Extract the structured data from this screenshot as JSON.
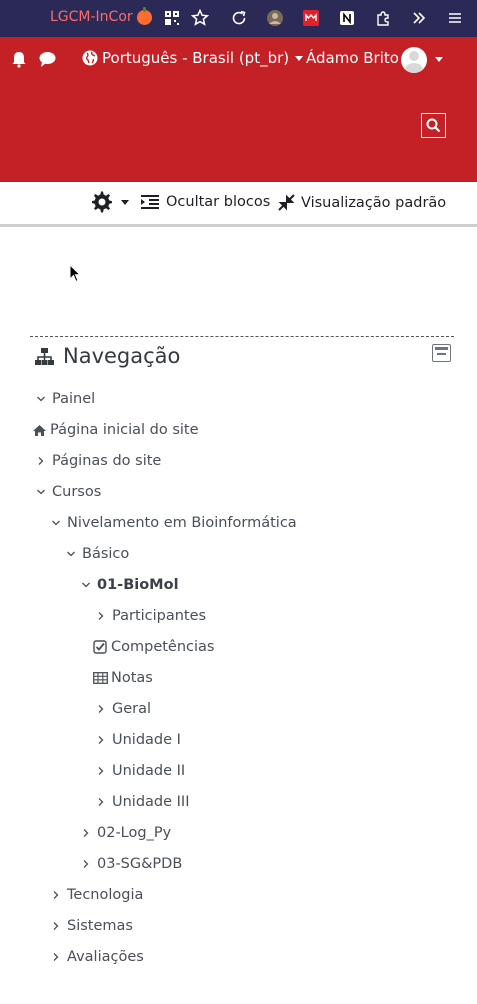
{
  "browser": {
    "tab_title": "LGCM-InCor",
    "icons": [
      "qr-icon",
      "bookmark-star-icon",
      "reload-icon",
      "extension-avatar-icon",
      "extension-red-icon",
      "notion-icon",
      "extensions-puzzle-icon",
      "overflow-chevrons-icon",
      "menu-icon"
    ]
  },
  "navbar": {
    "language": "Português - Brasil (pt_br)",
    "user_name": "Ádamo Brito",
    "bg_color": "#c42127"
  },
  "controls": {
    "hide_blocks": "Ocultar blocos",
    "standard_view": "Visualização padrão"
  },
  "navigation": {
    "title": "Navegação",
    "items": [
      {
        "label": "Painel",
        "icon": "chevron-down-icon"
      },
      {
        "label": "Página inicial do site",
        "icon": "home-icon"
      },
      {
        "label": "Páginas do site",
        "icon": "chevron-right-icon"
      },
      {
        "label": "Cursos",
        "icon": "chevron-down-icon"
      },
      {
        "label": "Nivelamento em Bioinformática",
        "icon": "chevron-down-icon"
      },
      {
        "label": "Básico",
        "icon": "chevron-down-icon"
      },
      {
        "label": "01-BioMol",
        "icon": "chevron-down-icon"
      },
      {
        "label": "Participantes",
        "icon": "chevron-right-icon"
      },
      {
        "label": "Competências",
        "icon": "checkbox-icon"
      },
      {
        "label": "Notas",
        "icon": "table-icon"
      },
      {
        "label": "Geral",
        "icon": "chevron-right-icon"
      },
      {
        "label": "Unidade I",
        "icon": "chevron-right-icon"
      },
      {
        "label": "Unidade II",
        "icon": "chevron-right-icon"
      },
      {
        "label": "Unidade III",
        "icon": "chevron-right-icon"
      },
      {
        "label": "02-Log_Py",
        "icon": "chevron-right-icon"
      },
      {
        "label": "03-SG&PDB",
        "icon": "chevron-right-icon"
      },
      {
        "label": "Tecnologia",
        "icon": "chevron-right-icon"
      },
      {
        "label": "Sistemas",
        "icon": "chevron-right-icon"
      },
      {
        "label": "Avaliações",
        "icon": "chevron-right-icon"
      }
    ]
  }
}
